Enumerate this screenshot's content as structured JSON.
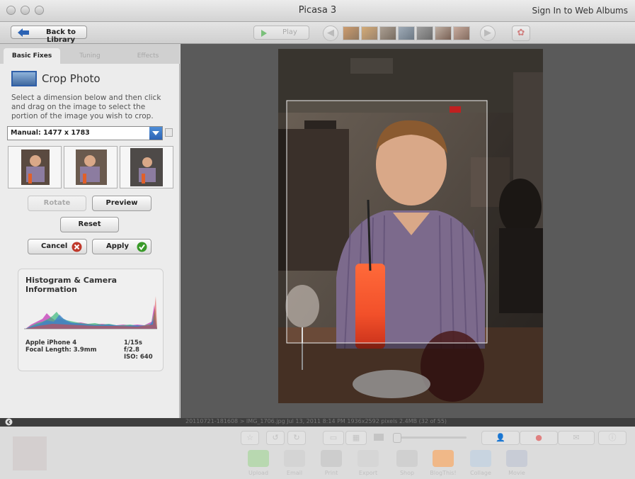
{
  "window": {
    "title": "Picasa 3",
    "signin": "Sign In to Web Albums"
  },
  "toolbar": {
    "back_label": "Back to Library",
    "play_label": "Play"
  },
  "tabs": [
    {
      "label": "Basic Fixes",
      "active": true
    },
    {
      "label": "Tuning",
      "active": false
    },
    {
      "label": "Effects",
      "active": false
    }
  ],
  "crop": {
    "title": "Crop Photo",
    "instructions": "Select a dimension below and then click and drag on the image to select the portion of the image you wish to crop.",
    "selected_dimension": "Manual: 1477 x 1783",
    "buttons": {
      "rotate": "Rotate",
      "preview": "Preview",
      "reset": "Reset",
      "cancel": "Cancel",
      "apply": "Apply"
    }
  },
  "histogram": {
    "title": "Histogram & Camera Information",
    "camera": "Apple iPhone 4",
    "focal_length": "Focal Length: 3.9mm",
    "shutter": "1/15s",
    "aperture": "f/2.8",
    "iso": "ISO: 640"
  },
  "status": {
    "text": "20110721-181608 > IMG_1706.jpg    Jul 13, 2011 8:14 PM    1936x2592 pixels    2.4MB    (32 of 55)"
  },
  "bottom_actions": [
    "Upload",
    "Email",
    "Print",
    "Export",
    "Shop",
    "BlogThis!",
    "Collage",
    "Movie"
  ],
  "colors": {
    "accent": "#2c63b4",
    "apply_green": "#3a9a2a",
    "cancel_red": "#c0392b",
    "viewer_bg": "#5a5a5a"
  }
}
